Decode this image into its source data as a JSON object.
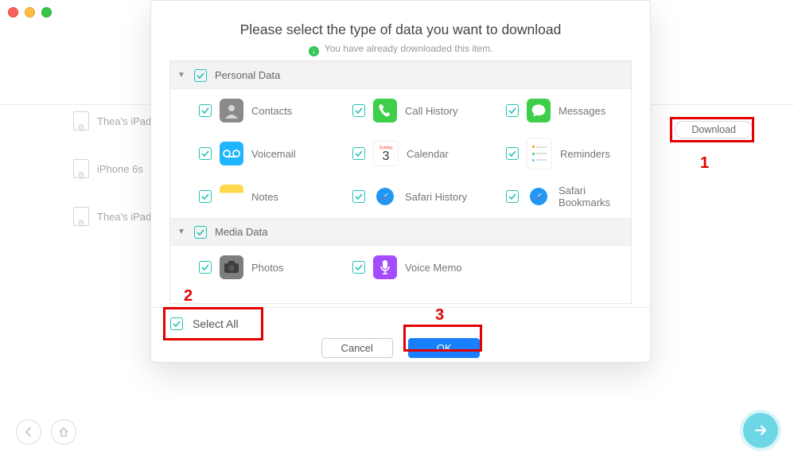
{
  "dialog": {
    "title": "Please select the type of data you want to download",
    "subtitle": "You have already downloaded this item.",
    "sections": [
      {
        "name": "Personal Data",
        "items": [
          {
            "label": "Contacts"
          },
          {
            "label": "Call History"
          },
          {
            "label": "Messages"
          },
          {
            "label": "Voicemail"
          },
          {
            "label": "Calendar"
          },
          {
            "label": "Reminders"
          },
          {
            "label": "Notes"
          },
          {
            "label": "Safari History"
          },
          {
            "label": "Safari Bookmarks"
          }
        ]
      },
      {
        "name": "Media Data",
        "items": [
          {
            "label": "Photos"
          },
          {
            "label": "Voice Memo"
          }
        ]
      }
    ],
    "select_all": "Select All",
    "cancel": "Cancel",
    "ok": "OK"
  },
  "sidebar": {
    "devices": [
      {
        "label": "Thea's iPad"
      },
      {
        "label": "iPhone 6s"
      },
      {
        "label": "Thea's iPad"
      }
    ]
  },
  "download_button": "Download",
  "annotations": {
    "step1": "1",
    "step2": "2",
    "step3": "3"
  },
  "calendar_icon": {
    "weekday": "Sunday",
    "day": "3"
  }
}
